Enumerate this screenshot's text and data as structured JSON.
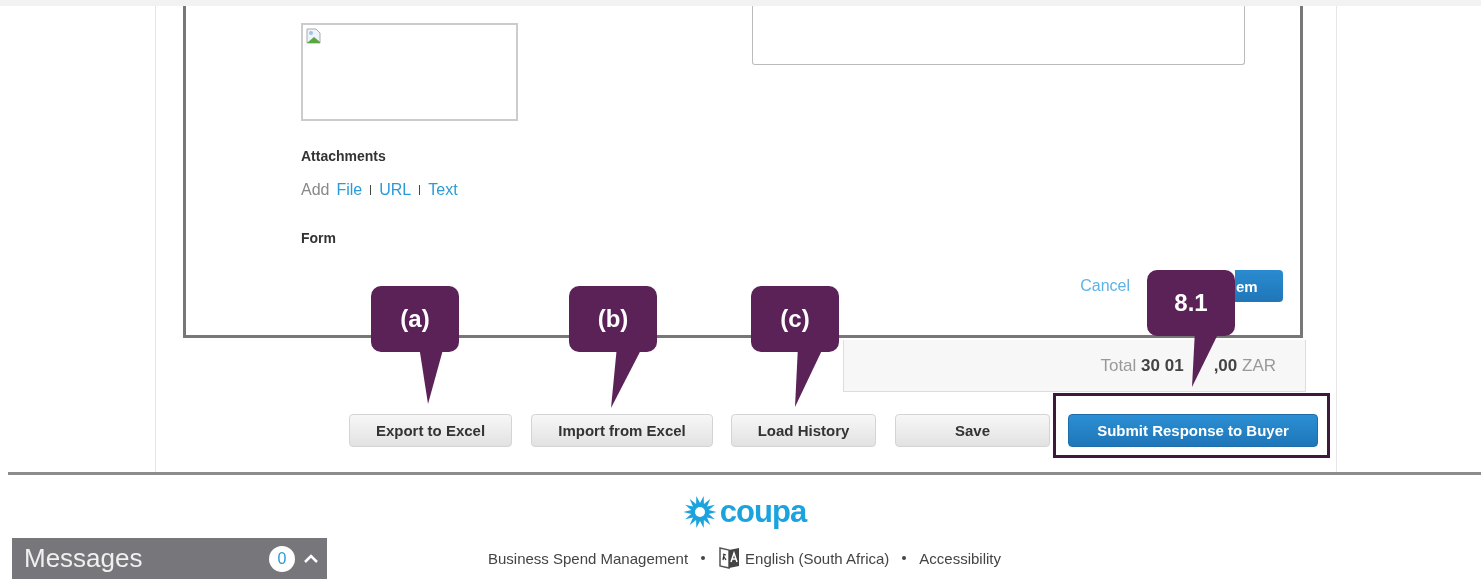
{
  "form": {
    "attachments_label": "Attachments",
    "add_label": "Add",
    "attachment_links": [
      "File",
      "URL",
      "Text"
    ],
    "form_label": "Form",
    "cancel_link": "Cancel",
    "save_button": "em"
  },
  "total": {
    "label": "Total",
    "amount_before": "30 01",
    "amount_after": ",00",
    "currency": "ZAR"
  },
  "actions": [
    {
      "label": "Export to Excel",
      "kind": "plain"
    },
    {
      "label": "Import from Excel",
      "kind": "plain"
    },
    {
      "label": "Load History",
      "kind": "plain"
    },
    {
      "label": "Save",
      "kind": "plain"
    },
    {
      "label": "Submit Response to Buyer",
      "kind": "primary",
      "highlighted": true
    }
  ],
  "callouts": [
    {
      "label": "(a)"
    },
    {
      "label": "(b)"
    },
    {
      "label": "(c)"
    },
    {
      "label": "8.1"
    }
  ],
  "footer": {
    "logo": "coupa",
    "links": [
      "Business Spend Management",
      "English (South Africa)",
      "Accessibility"
    ]
  },
  "messages": {
    "title": "Messages",
    "count": "0"
  }
}
